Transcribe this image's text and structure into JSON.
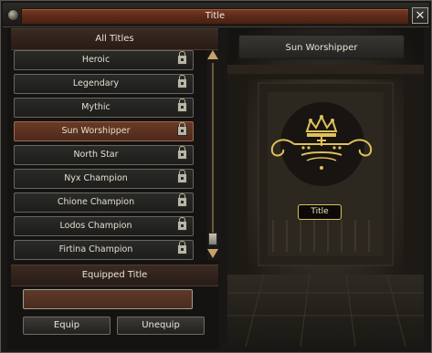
{
  "window": {
    "title": "Title",
    "close_glyph": "✕"
  },
  "titles_panel": {
    "header": "All Titles",
    "items": [
      {
        "label": "Heroic",
        "locked": true
      },
      {
        "label": "Legendary",
        "locked": true
      },
      {
        "label": "Mythic",
        "locked": true
      },
      {
        "label": "Sun Worshipper",
        "locked": true,
        "selected": true
      },
      {
        "label": "North Star",
        "locked": true
      },
      {
        "label": "Nyx Champion",
        "locked": true
      },
      {
        "label": "Chione Champion",
        "locked": true
      },
      {
        "label": "Lodos Champion",
        "locked": true
      },
      {
        "label": "Firtina Champion",
        "locked": true
      }
    ]
  },
  "equipped": {
    "header": "Equipped Title",
    "value": "",
    "equip_label": "Equip",
    "unequip_label": "Unequip"
  },
  "preview": {
    "selected_title": "Sun Worshipper",
    "badge_label": "Title",
    "emblem_icon": "crown-emblem-icon"
  },
  "colors": {
    "accent_gold": "#e0c15a",
    "selected_row": "#6a3a26",
    "header_bar": "#5a2818"
  }
}
